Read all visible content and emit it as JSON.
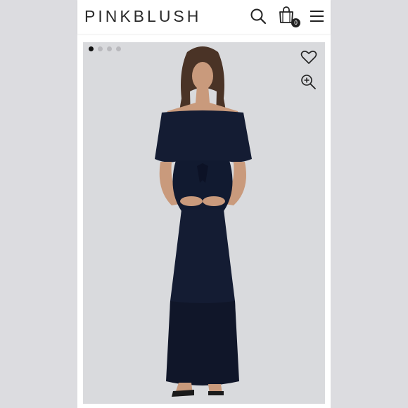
{
  "header": {
    "logo_text": "PINKBLUSH",
    "cart_count": "0",
    "icons": [
      "search-icon",
      "shopping-bag-icon",
      "hamburger-menu-icon"
    ]
  },
  "gallery": {
    "slide_count": 4,
    "active_slide": 1,
    "icons": [
      "heart-icon",
      "zoom-in-icon"
    ],
    "image_subject": "navy-off-shoulder-maxi-dress",
    "colors": {
      "dress": "#141c33",
      "background": "#d9dadd"
    }
  }
}
